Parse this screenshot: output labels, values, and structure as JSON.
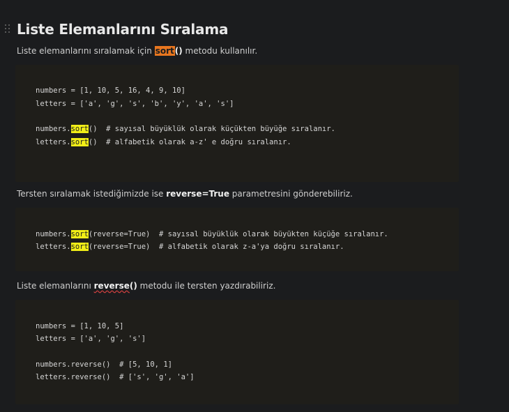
{
  "heading": "Liste Elemanlarını Sıralama",
  "para1": {
    "before": "Liste elemanlarını sıralamak için ",
    "highlight": "sort",
    "bold_after": "()",
    "after": " metodu kullanılır."
  },
  "code1": {
    "line1": "numbers = [1, 10, 5, 16, 4, 9, 10]",
    "line2": "letters = ['a', 'g', 's', 'b', 'y', 'a', 's']",
    "line3_prefix": "numbers.",
    "line3_hl": "sort",
    "line3_suffix": "()  # sayısal büyüklük olarak küçükten büyüğe sıralanır.",
    "line4_prefix": "letters.",
    "line4_hl": "sort",
    "line4_suffix": "()  # alfabetik olarak a-z' e doğru sıralanır."
  },
  "para2": {
    "before": "Tersten sıralamak istediğimizde ise ",
    "bold": "reverse=True",
    "after": " parametresini gönderebiliriz."
  },
  "code2": {
    "line1_prefix": "numbers.",
    "line1_hl": "sort",
    "line1_suffix": "(reverse=True)  # sayısal büyüklük olarak büyükten küçüğe sıralanır.",
    "line2_prefix": "letters.",
    "line2_hl": "sort",
    "line2_suffix": "(reverse=True)  # alfabetik olarak z-a'ya doğru sıralanır."
  },
  "para3": {
    "before": "Liste elemanlarını ",
    "bold_squiggle": "reverse",
    "bold_after": "()",
    "after": " metodu ile tersten yazdırabiliriz."
  },
  "code3": {
    "line1": "numbers = [1, 10, 5]",
    "line2": "letters = ['a', 'g', 's']",
    "line3": "numbers.reverse()  # [5, 10, 1]",
    "line4": "letters.reverse()  # ['s', 'g', 'a']"
  }
}
